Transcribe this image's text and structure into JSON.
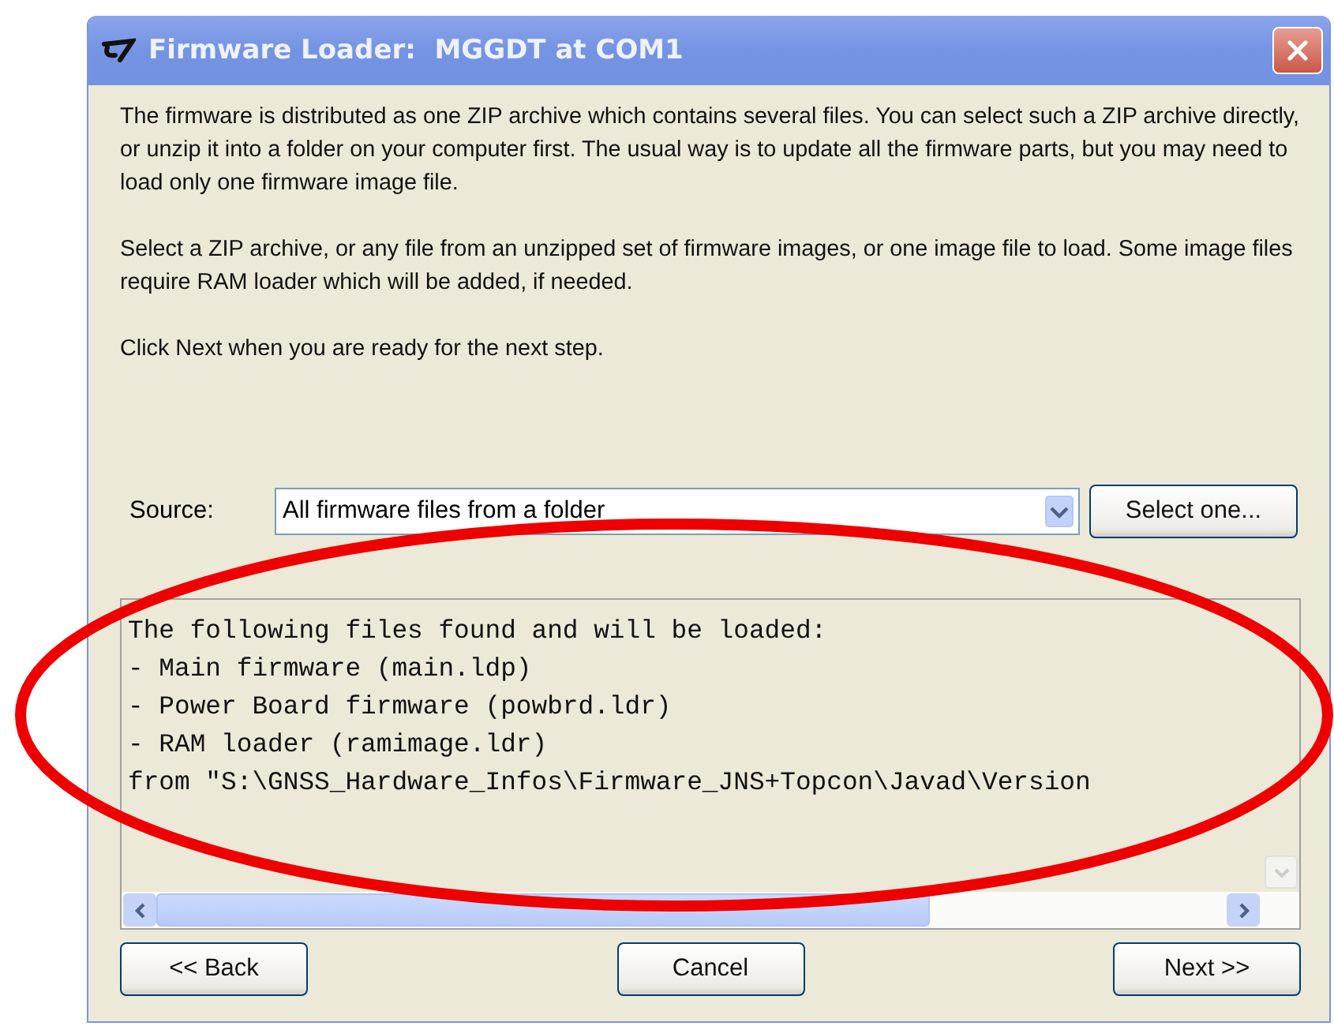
{
  "window": {
    "title": "Firmware Loader:  MGGDT at COM1"
  },
  "paragraphs": [
    "The firmware is distributed as one ZIP archive which contains several files. You can select such a ZIP archive directly, or unzip it into a folder on your computer first. The usual way is to update all the firmware parts, but you may need to load only one firmware image file.",
    "Select a ZIP archive, or any file from an unzipped set of firmware images, or one image file to load. Some image files require RAM loader which will be added, if needed.",
    "Click Next when you are ready for the next step."
  ],
  "source": {
    "label": "Source:",
    "value": "All firmware files from a folder",
    "button": "Select one..."
  },
  "log_lines": [
    "The following files found and will be loaded:",
    "- Main firmware (main.ldp)",
    "- Power Board firmware (powbrd.ldr)",
    "- RAM loader (ramimage.ldr)",
    "from \"S:\\GNSS_Hardware_Infos\\Firmware_JNS+Topcon\\Javad\\Version"
  ],
  "buttons": [
    {
      "label": "<< Back"
    },
    {
      "label": "Cancel"
    },
    {
      "label": "Next >>"
    }
  ]
}
